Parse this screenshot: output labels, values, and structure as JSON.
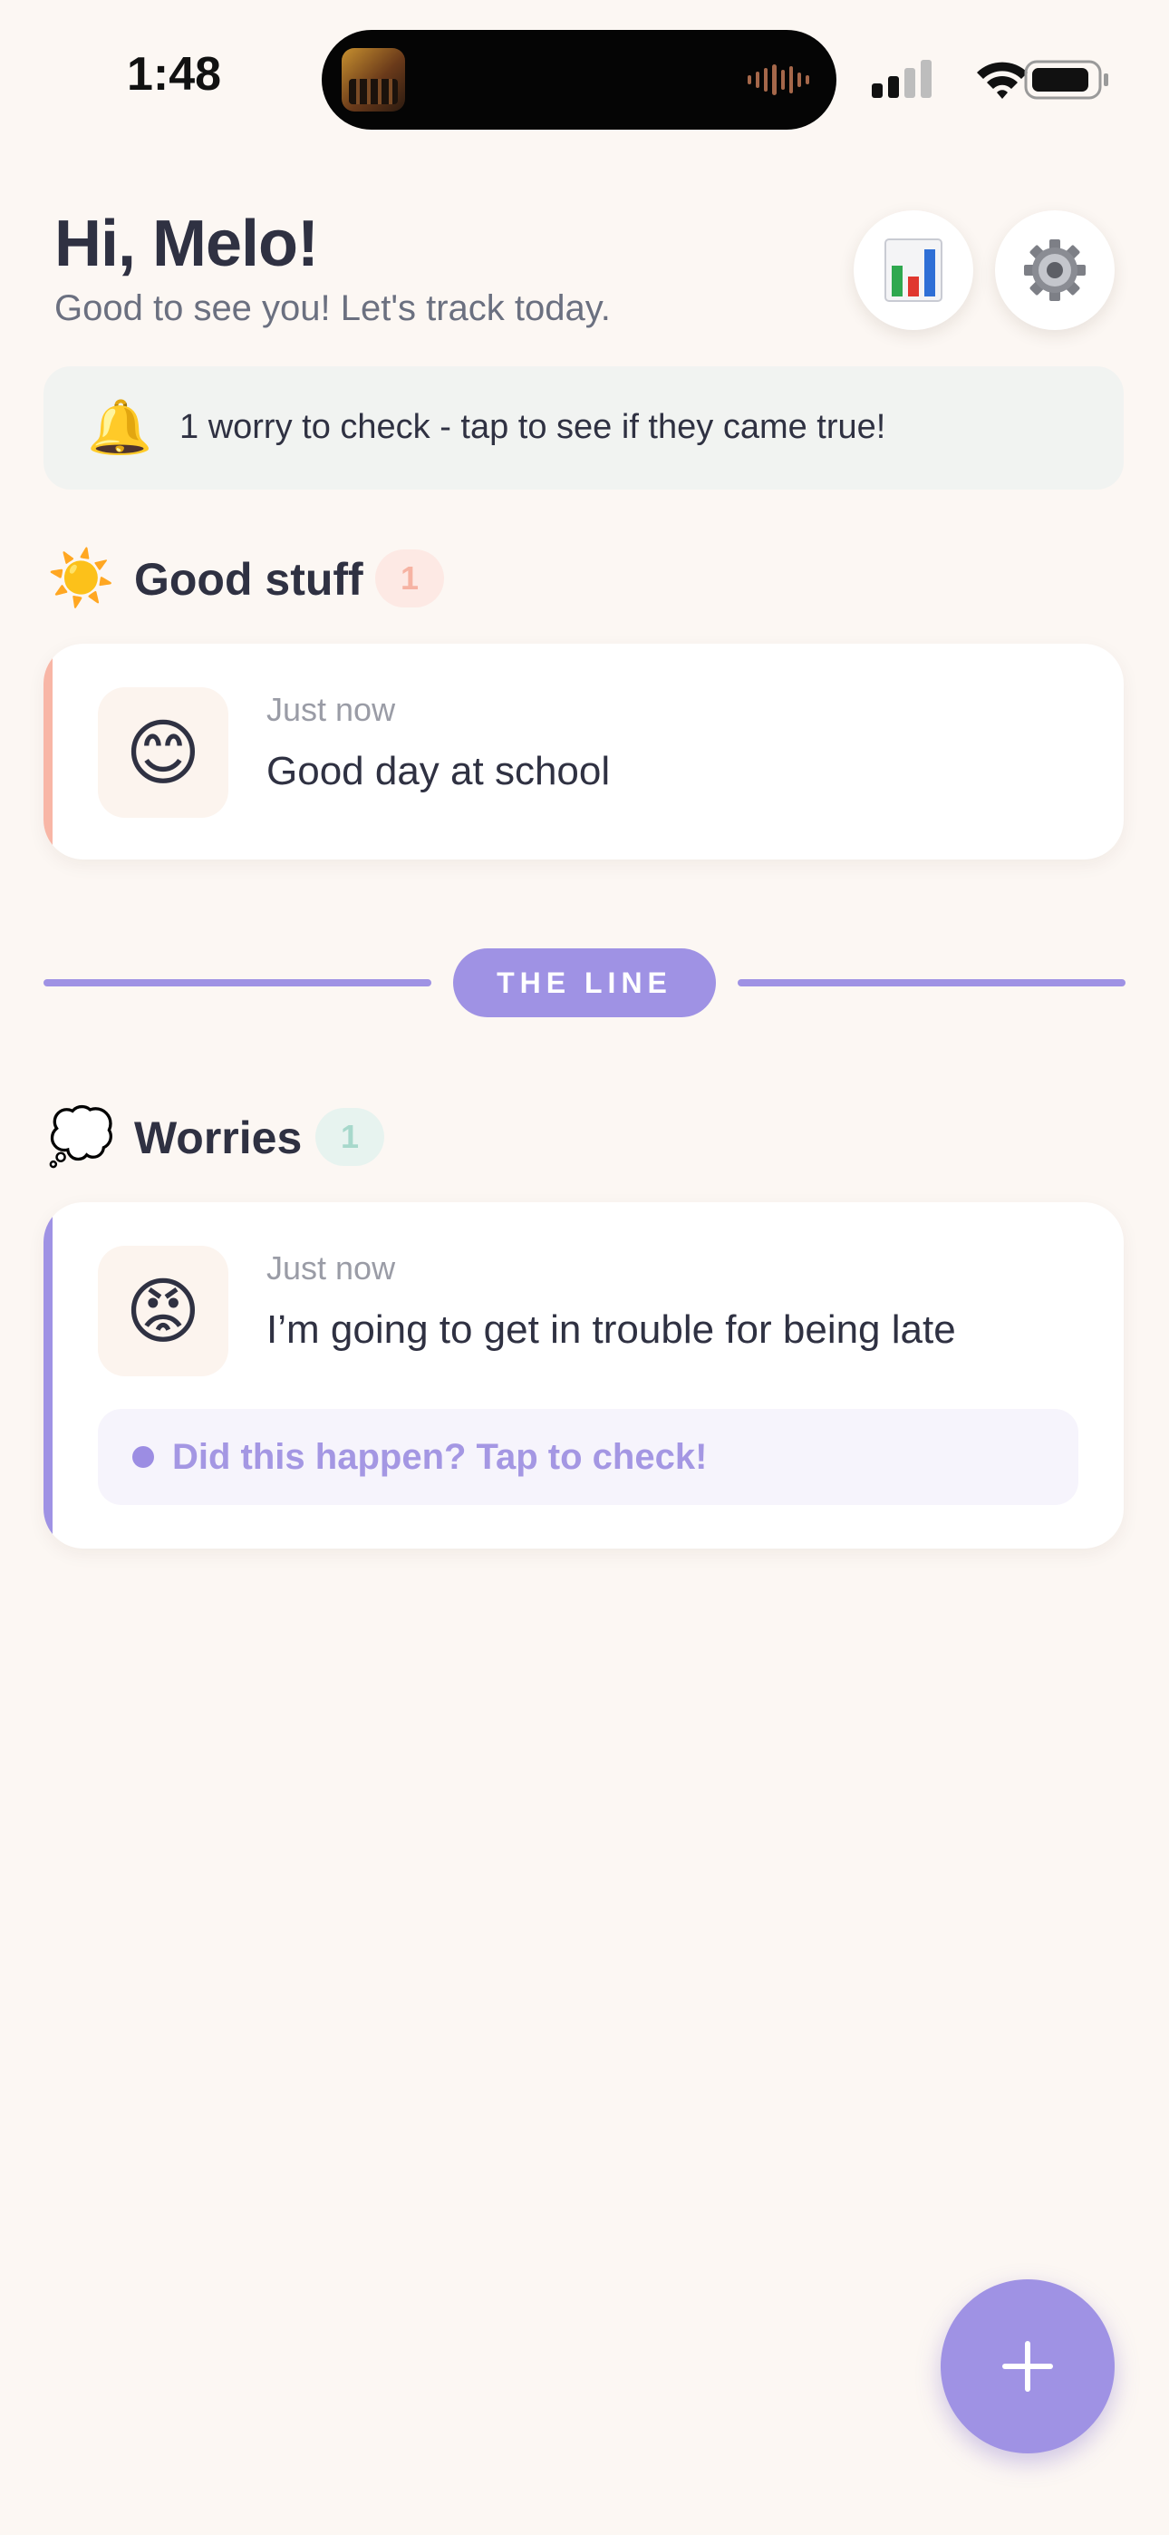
{
  "status_bar": {
    "time": "1:48"
  },
  "header": {
    "greeting": "Hi, Melo!",
    "subtitle": "Good to see you! Let's track today."
  },
  "notice": {
    "icon": "bell-icon",
    "text": "1 worry to check - tap to see if they came true!"
  },
  "good_stuff": {
    "icon": "sun-icon",
    "title": "Good stuff",
    "count": "1",
    "accent_color": "#f8b6a6",
    "entries": [
      {
        "emoji": "😊",
        "time": "Just now",
        "text": "Good day at school"
      }
    ]
  },
  "divider": {
    "label": "THE LINE",
    "color": "#9f92e4"
  },
  "worries": {
    "icon": "thought-bubble-icon",
    "title": "Worries",
    "count": "1",
    "accent_color": "#9f92e4",
    "entries": [
      {
        "emoji": "😡",
        "time": "Just now",
        "text": "I’m going to get in trouble for being late",
        "check_prompt": "Did this happen? Tap to check!"
      }
    ]
  },
  "fab": {
    "icon": "plus-icon"
  }
}
